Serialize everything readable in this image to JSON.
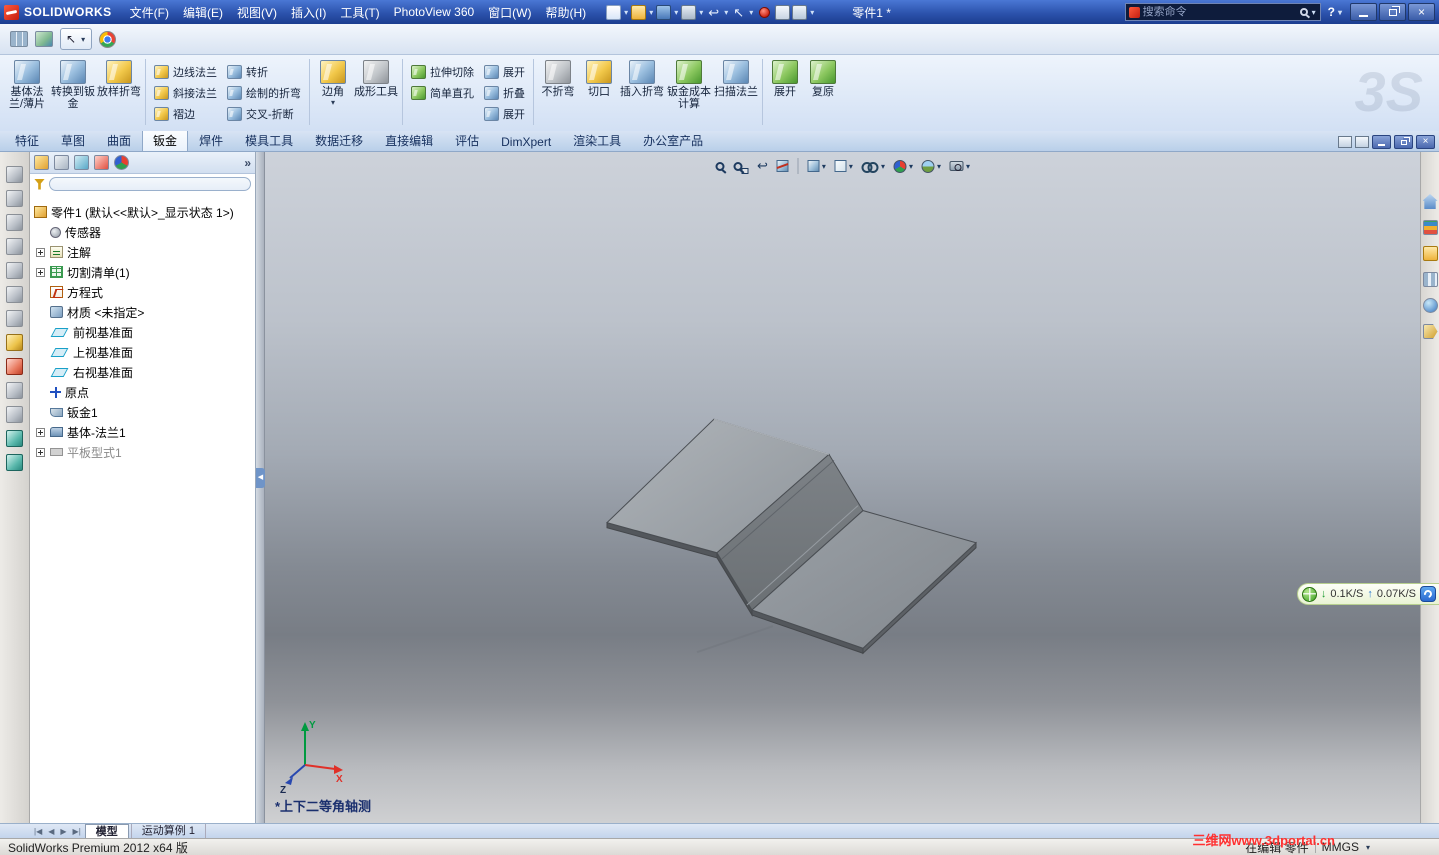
{
  "app": {
    "name": "SOLIDWORKS",
    "doc_title": "零件1 *",
    "help": "?"
  },
  "branding": {
    "ds_watermark": "3S"
  },
  "titlebar": {
    "menus": [
      "文件(F)",
      "编辑(E)",
      "视图(V)",
      "插入(I)",
      "工具(T)",
      "PhotoView 360",
      "窗口(W)",
      "帮助(H)"
    ],
    "search_placeholder": "搜索命令"
  },
  "ribbon": {
    "tabs": [
      "特征",
      "草图",
      "曲面",
      "钣金",
      "焊件",
      "模具工具",
      "数据迁移",
      "直接编辑",
      "评估",
      "DimXpert",
      "渲染工具",
      "办公室产品"
    ],
    "active_tab": "钣金",
    "buttons": {
      "base_flange": "基体法兰/薄片",
      "convert_to_sheetmetal": "转换到钣金",
      "lofted_bend": "放样折弯",
      "edge_flange": "边线法兰",
      "miter_flange": "斜接法兰",
      "hem": "褶边",
      "jog": "转折",
      "sketched_bend": "绘制的折弯",
      "cross_break": "交叉-折断",
      "corner": "边角",
      "forming_tool": "成形工具",
      "extruded_cut": "拉伸切除",
      "simple_hole": "简单直孔",
      "unfold": "展开",
      "fold": "折叠",
      "flatten_a": "展开",
      "no_bends": "不折弯",
      "rip": "切口",
      "insert_bends": "插入折弯",
      "sheetmetal_costing": "钣金成本计算",
      "swept_flange": "扫描法兰",
      "flatten_b": "展开",
      "restore": "复原"
    }
  },
  "tree": {
    "root": "零件1 (默认<<默认>_显示状态 1>)",
    "items": [
      {
        "label": "传感器"
      },
      {
        "label": "注解"
      },
      {
        "label": "切割清单(1)"
      },
      {
        "label": "方程式"
      },
      {
        "label": "材质 <未指定>"
      },
      {
        "label": "前视基准面"
      },
      {
        "label": "上视基准面"
      },
      {
        "label": "右视基准面"
      },
      {
        "label": "原点"
      },
      {
        "label": "钣金1"
      },
      {
        "label": "基体-法兰1"
      },
      {
        "label": "平板型式1"
      }
    ]
  },
  "viewport": {
    "view_label": "*上下二等角轴测",
    "axes": {
      "x": "X",
      "y": "Y",
      "z": "Z"
    }
  },
  "net_widget": {
    "down": "0.1K/S",
    "up": "0.07K/S"
  },
  "bottom": {
    "tabs": [
      "模型",
      "运动算例 1"
    ]
  },
  "statusbar": {
    "product": "SolidWorks Premium 2012 x64 版",
    "editing": "在编辑 零件",
    "units": "MMGS",
    "watermark": "三维网www.3dportal.cn"
  },
  "colors": {
    "titlebar_blue": "#2c53ad",
    "accent_red": "#c41e10",
    "viewport_top": "#cdd2da",
    "viewport_mid": "#787d85",
    "part_gray": "#8d9298",
    "watermark_red": "#ff3030",
    "plane_cyan": "#18a0c8"
  }
}
